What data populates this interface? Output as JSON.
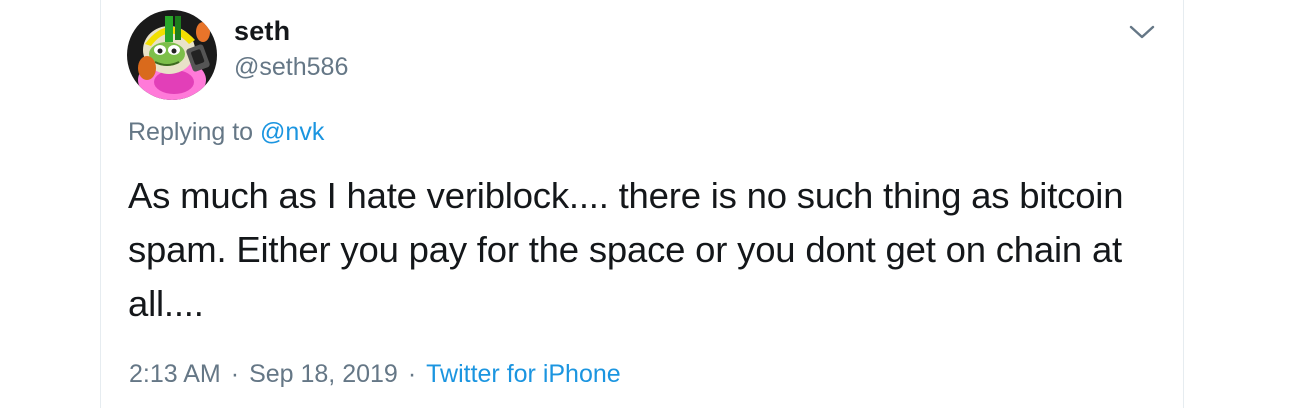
{
  "tweet": {
    "author": {
      "display_name": "seth",
      "handle": "@seth586"
    },
    "replying_prefix": "Replying to ",
    "replying_to": "@nvk",
    "text": "As much as I hate veriblock.... there is no such thing as bitcoin spam. Either you pay for the space or you dont get on chain at all....",
    "time": "2:13 AM",
    "date": "Sep 18, 2019",
    "separator": "·",
    "source": "Twitter for iPhone"
  },
  "icons": {
    "more_menu": "chevron-down-icon",
    "avatar": "avatar"
  },
  "colors": {
    "primary_text": "#14171a",
    "secondary_text": "#657786",
    "link": "#1b95e0",
    "border": "#e6ecf0"
  }
}
